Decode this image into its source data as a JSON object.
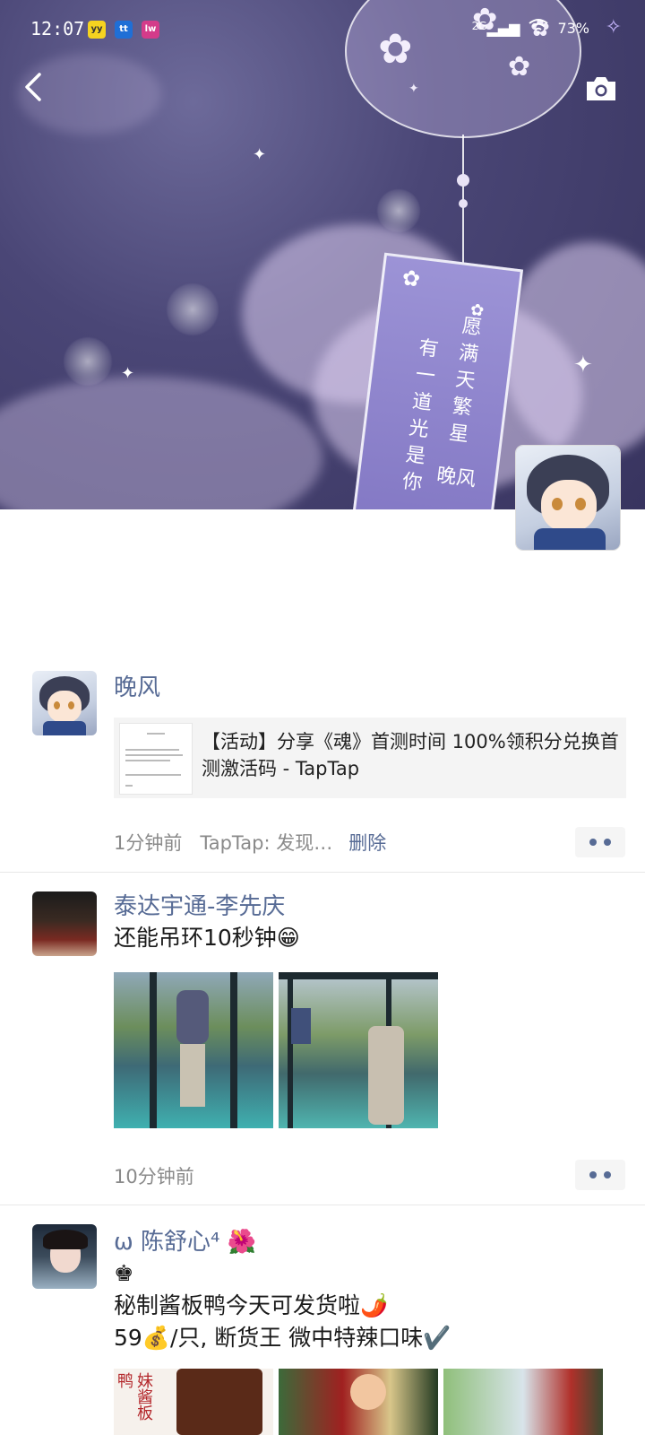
{
  "status_bar": {
    "time": "12:07",
    "network": "2G",
    "battery": "73%",
    "apps": [
      "yy",
      "tt",
      "lw"
    ]
  },
  "cover": {
    "tag_line_1": "愿满天繁星",
    "tag_line_2": "有一道光是你",
    "tag_signature": "晚风"
  },
  "profile": {
    "name": "晚风"
  },
  "posts": [
    {
      "nickname": "晚风",
      "share_title": "【活动】分享《魂》首测时间 100%领积分兑换首测激活码 - TapTap",
      "time": "1分钟前",
      "source": "TapTap: 发现…",
      "delete_label": "删除"
    },
    {
      "nickname": "泰达宇通-李先庆",
      "text": "还能吊环10秒钟😁",
      "time": "10分钟前"
    },
    {
      "nickname": "ω  陈舒心⁴ 🌺",
      "text_line_1": "♚",
      "text_line_2": "秘制酱板鸭今天可发货啦🌶️",
      "text_line_3": "59💰/只, 断货王 微中特辣口味✔️",
      "photo_caption": "妹酱板鸭"
    }
  ],
  "colors": {
    "nickname": "#576b95",
    "meta": "#8a8a8a",
    "cover_bg": "#4a4676"
  },
  "icons": [
    "back-arrow-icon",
    "camera-icon",
    "more-dots-icon",
    "wifi-icon",
    "signal-icon",
    "sparkle-icon"
  ]
}
